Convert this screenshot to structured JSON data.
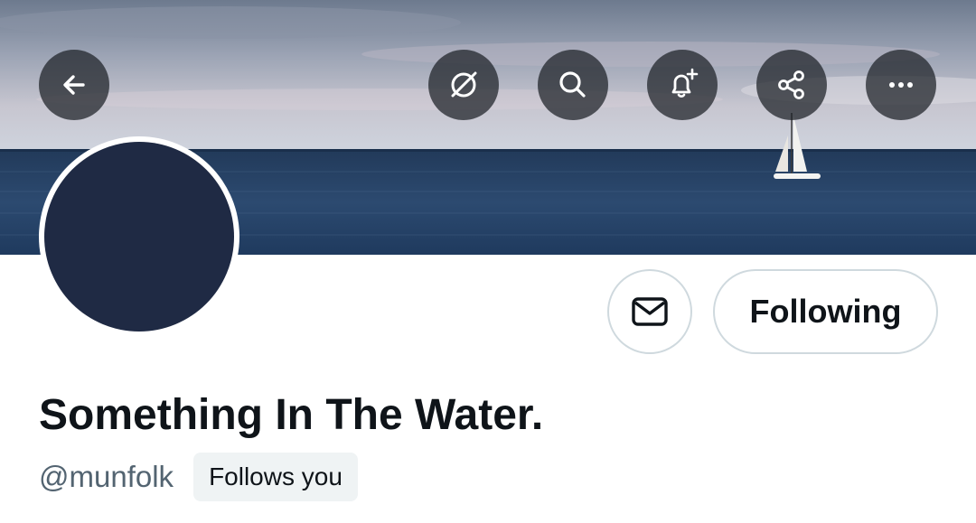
{
  "profile": {
    "display_name": "Something In The Water.",
    "handle": "@munfolk",
    "follows_you_badge": "Follows you"
  },
  "actions": {
    "following_label": "Following"
  },
  "icons": {
    "back": "arrow-left-icon",
    "grok": "grok-icon",
    "search": "search-icon",
    "notify": "bell-plus-icon",
    "share": "share-icon",
    "more": "more-icon",
    "message": "envelope-icon"
  },
  "colors": {
    "text_primary": "#0f1419",
    "text_secondary": "#536471",
    "avatar": "#1f2a44",
    "badge_bg": "#eff3f4",
    "button_border": "#cfd9de"
  }
}
